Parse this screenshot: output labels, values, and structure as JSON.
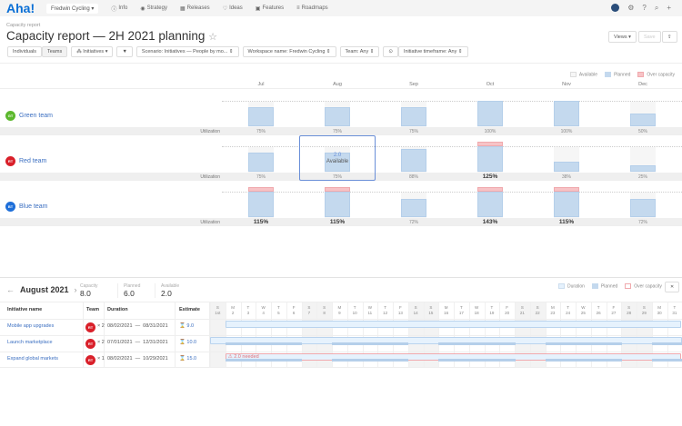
{
  "topbar": {
    "logo": "Aha!",
    "workspace": "Fredwin Cycling ▾",
    "nav": [
      {
        "icon": "info-icon",
        "glyph": "ⓘ",
        "label": "Info"
      },
      {
        "icon": "strategy-icon",
        "glyph": "◉",
        "label": "Strategy"
      },
      {
        "icon": "releases-icon",
        "glyph": "▦",
        "label": "Releases"
      },
      {
        "icon": "ideas-icon",
        "glyph": "♡",
        "label": "Ideas"
      },
      {
        "icon": "features-icon",
        "glyph": "▣",
        "label": "Features"
      },
      {
        "icon": "roadmaps-icon",
        "glyph": "≡",
        "label": "Roadmaps"
      }
    ]
  },
  "header": {
    "breadcrumb": "Capacity report",
    "title": "Capacity report — 2H 2021 planning",
    "views": "Views ▾",
    "save": "Save"
  },
  "filters": {
    "individuals": "Individuals",
    "teams": "Teams",
    "initiatives": "Initiatives ▾",
    "scenario": "Scenario: Initiatives — People by mo... ⇕",
    "workspace": "Workspace name: Fredwin Cycling ⇕",
    "team": "Team: Any ⇕",
    "timeframe": "Initiative timeframe: Any ⇕"
  },
  "legend": {
    "available": "Available",
    "planned": "Planned",
    "over": "Over capacity"
  },
  "colors": {
    "planned": "#c4d9ee",
    "over": "#f7c3c6",
    "available": "#f6f6f6",
    "link": "#3b6fc1"
  },
  "chart_data": {
    "type": "bar",
    "categories": [
      "Jul",
      "Aug",
      "Sep",
      "Oct",
      "Nov",
      "Dec"
    ],
    "util_label": "Utilization",
    "series": [
      {
        "name": "Green team",
        "initials": "GT",
        "color": "#5cb82e",
        "values": [
          75,
          75,
          75,
          100,
          100,
          50
        ]
      },
      {
        "name": "Red team",
        "initials": "RT",
        "color": "#d9202a",
        "values": [
          75,
          75,
          88,
          125,
          38,
          25
        ]
      },
      {
        "name": "Blue team",
        "initials": "BT",
        "color": "#1e6fd9",
        "values": [
          115,
          115,
          72,
          143,
          115,
          72
        ]
      }
    ]
  },
  "tooltip": {
    "value": "2.0",
    "label": "Available"
  },
  "detail": {
    "month": "August 2021",
    "stats": [
      {
        "label": "Capacity",
        "value": "8.0"
      },
      {
        "label": "Planned",
        "value": "6.0"
      },
      {
        "label": "Available",
        "value": "2.0"
      }
    ],
    "legend": {
      "duration": "Duration",
      "planned": "Planned",
      "over": "Over capacity"
    },
    "close": "✕",
    "columns": [
      "Initiative name",
      "Team",
      "Duration",
      "Estimate"
    ],
    "rows": [
      {
        "name": "Mobile app upgrades",
        "team": "RT",
        "count": "× 2",
        "duration": "08/02/2021  —  08/31/2021",
        "estimate": "9.0"
      },
      {
        "name": "Launch marketplace",
        "team": "RT",
        "count": "× 2",
        "duration": "07/01/2021  —  12/31/2021",
        "estimate": "10.0"
      },
      {
        "name": "Expand global markets",
        "team": "RT",
        "count": "× 1",
        "duration": "08/02/2021  —  10/29/2021",
        "estimate": "15.0",
        "warning": "⚠ 2.0 needed"
      }
    ],
    "days": [
      [
        "S",
        "1st"
      ],
      [
        "M",
        "2"
      ],
      [
        "T",
        "3"
      ],
      [
        "W",
        "4"
      ],
      [
        "T",
        "5"
      ],
      [
        "F",
        "6"
      ],
      [
        "S",
        "7"
      ],
      [
        "S",
        "8"
      ],
      [
        "M",
        "9"
      ],
      [
        "T",
        "10"
      ],
      [
        "W",
        "11"
      ],
      [
        "T",
        "12"
      ],
      [
        "F",
        "13"
      ],
      [
        "S",
        "14"
      ],
      [
        "S",
        "15"
      ],
      [
        "M",
        "16"
      ],
      [
        "T",
        "17"
      ],
      [
        "W",
        "18"
      ],
      [
        "T",
        "19"
      ],
      [
        "F",
        "20"
      ],
      [
        "S",
        "21"
      ],
      [
        "S",
        "22"
      ],
      [
        "M",
        "23"
      ],
      [
        "T",
        "24"
      ],
      [
        "W",
        "25"
      ],
      [
        "T",
        "26"
      ],
      [
        "F",
        "27"
      ],
      [
        "S",
        "28"
      ],
      [
        "S",
        "29"
      ],
      [
        "M",
        "30"
      ],
      [
        "T",
        "31"
      ]
    ]
  }
}
